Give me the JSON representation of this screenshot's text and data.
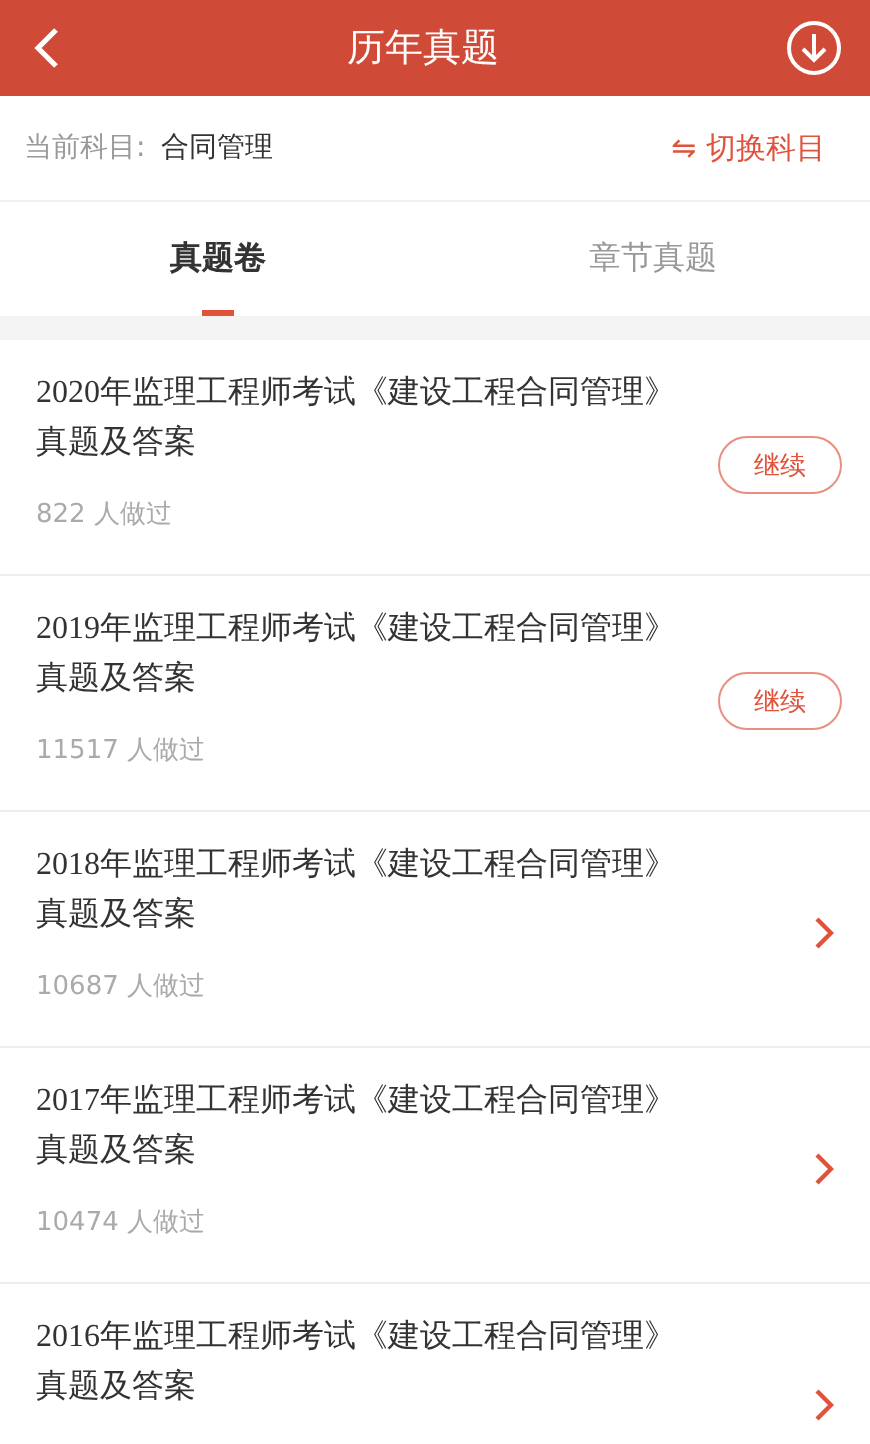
{
  "header": {
    "title": "历年真题"
  },
  "subject": {
    "label": "当前科目:",
    "value": "合同管理",
    "switch": "⇋ 切换科目"
  },
  "tabs": [
    {
      "label": "真题卷",
      "selected": true
    },
    {
      "label": "章节真题",
      "selected": false
    }
  ],
  "papers": [
    {
      "title": "2020年监理工程师考试《建设工程合同管理》真题及答案",
      "count": "822 人做过",
      "kind": "resume",
      "button": "继续"
    },
    {
      "title": "2019年监理工程师考试《建设工程合同管理》真题及答案",
      "count": "11517 人做过",
      "kind": "resume",
      "button": "继续"
    },
    {
      "title": "2018年监理工程师考试《建设工程合同管理》真题及答案",
      "count": "10687 人做过",
      "kind": "open"
    },
    {
      "title": "2017年监理工程师考试《建设工程合同管理》真题及答案",
      "count": "10474 人做过",
      "kind": "open"
    },
    {
      "title": "2016年监理工程师考试《建设工程合同管理》真题及答案",
      "kind": "open"
    }
  ]
}
